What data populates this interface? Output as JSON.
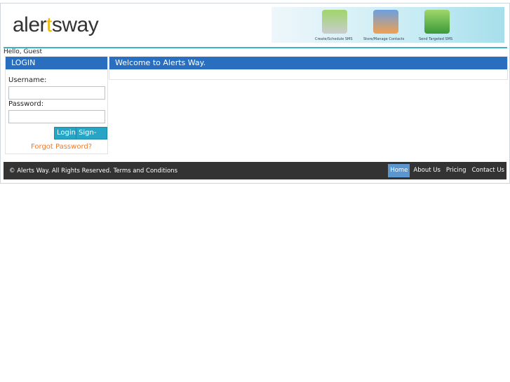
{
  "header": {
    "logo_text_a": "aler",
    "logo_text_t": "t",
    "logo_text_b": "sway",
    "banner": [
      {
        "label": "Create/Schedule SMS",
        "icon": "envelope-clock-icon"
      },
      {
        "label": "Store/Manage Contacts",
        "icon": "contacts-list-icon"
      },
      {
        "label": "Send Targeted SMS",
        "icon": "users-envelope-icon"
      }
    ]
  },
  "greeting": "Hello, Guest",
  "login": {
    "title": "LOGIN",
    "username_label": "Username:",
    "password_label": "Password:",
    "username_value": "",
    "password_value": "",
    "login_button": "Login",
    "signup_button": "Sign-up",
    "forgot": "Forgot Password?"
  },
  "main": {
    "title": "Welcome to Alerts Way."
  },
  "footer": {
    "copyright": "© Alerts Way. All Rights Reserved.",
    "terms": "Terms and Conditions",
    "nav": [
      "Home",
      "About Us",
      "Pricing",
      "Contact Us"
    ]
  },
  "colors": {
    "accent": "#2a6fbf",
    "teal": "#28a5c5",
    "footer": "#333333",
    "link_orange": "#f07a2a"
  }
}
